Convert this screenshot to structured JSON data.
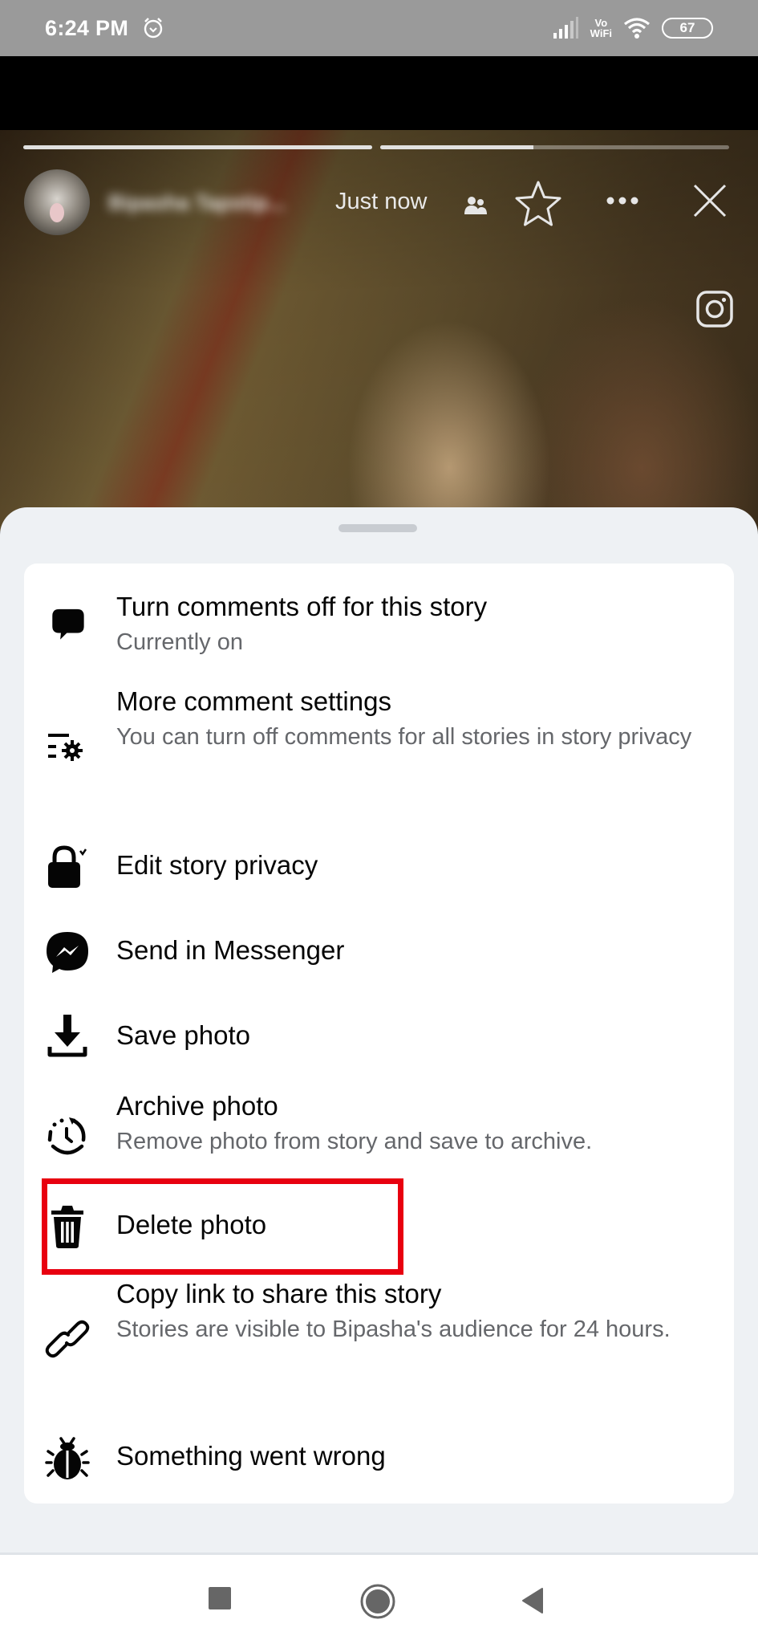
{
  "status_bar": {
    "time": "6:24 PM",
    "alarm_icon": "alarm-clock-icon",
    "signal_icon": "cellular-signal-icon",
    "vowifi_line1": "Vo",
    "vowifi_line2": "WiFi",
    "wifi_icon": "wifi-icon",
    "battery_level": "67"
  },
  "story": {
    "progress_segments": [
      {
        "fraction": 1.0
      },
      {
        "fraction": 0.44
      }
    ],
    "author_name": "Bipasha Tapstip...",
    "timestamp": "Just now",
    "audience_icon": "friends-audience-icon",
    "actions": [
      "star-icon",
      "more-icon",
      "close-icon"
    ],
    "crosspost_icon": "instagram-icon"
  },
  "menu": {
    "items": [
      {
        "icon": "comment-bubble-icon",
        "title": "Turn comments off for this story",
        "subtitle": "Currently on"
      },
      {
        "icon": "comment-settings-icon",
        "title": "More comment settings",
        "subtitle": "You can turn off comments for all stories in story privacy"
      },
      {
        "icon": "lock-privacy-icon",
        "title": "Edit story privacy",
        "subtitle": ""
      },
      {
        "icon": "messenger-icon",
        "title": "Send in Messenger",
        "subtitle": ""
      },
      {
        "icon": "download-icon",
        "title": "Save photo",
        "subtitle": ""
      },
      {
        "icon": "archive-clock-icon",
        "title": "Archive photo",
        "subtitle": "Remove photo from story and save to archive."
      },
      {
        "icon": "trash-icon",
        "title": "Delete photo",
        "subtitle": ""
      },
      {
        "icon": "link-icon",
        "title": "Copy link to share this story",
        "subtitle": "Stories are visible to Bipasha's audience for 24 hours."
      },
      {
        "icon": "bug-icon",
        "title": "Something went wrong",
        "subtitle": ""
      }
    ],
    "highlighted_item": "Delete photo",
    "highlight_color": "#e8000f"
  },
  "nav_bar": {
    "buttons": [
      "recents-square-icon",
      "home-circle-icon",
      "back-triangle-icon"
    ]
  }
}
